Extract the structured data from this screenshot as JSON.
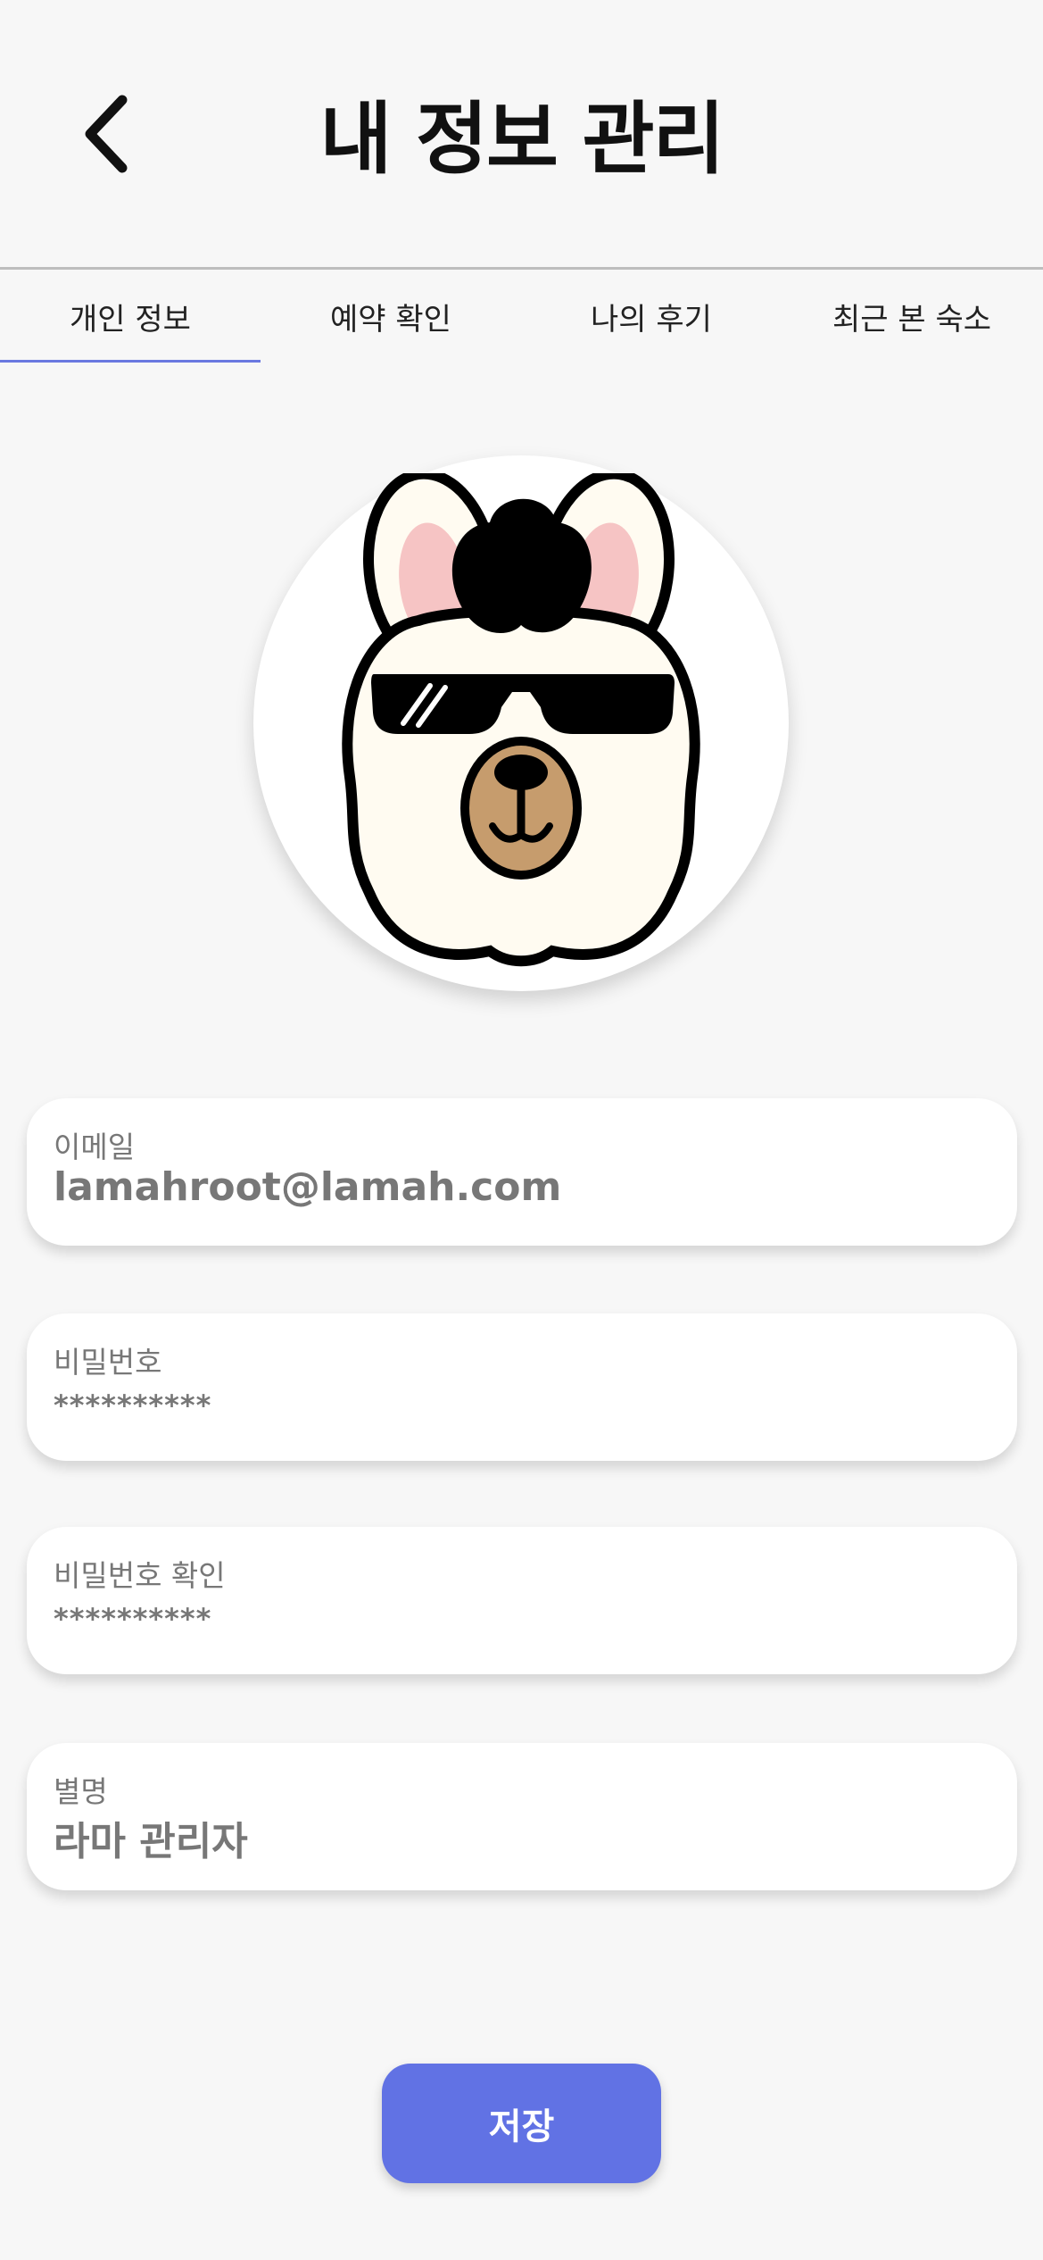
{
  "header": {
    "title": "내 정보 관리",
    "back_icon": "chevron-left-icon"
  },
  "tabs": [
    {
      "label": "개인 정보",
      "active": true
    },
    {
      "label": "예약 확인",
      "active": false
    },
    {
      "label": "나의 후기",
      "active": false
    },
    {
      "label": "최근 본 숙소",
      "active": false
    }
  ],
  "colors": {
    "accent": "#6172e4",
    "tab_underline": "#6a78e0",
    "background": "#f7f7f7"
  },
  "form": {
    "email": {
      "label": "이메일",
      "value": "lamahroot@lamah.com"
    },
    "password": {
      "label": "비밀번호",
      "value": "**********"
    },
    "password_confirm": {
      "label": "비밀번호 확인",
      "value": "**********"
    },
    "nickname": {
      "label": "별명",
      "value": "라마 관리자"
    }
  },
  "save_button": {
    "label": "저장"
  }
}
